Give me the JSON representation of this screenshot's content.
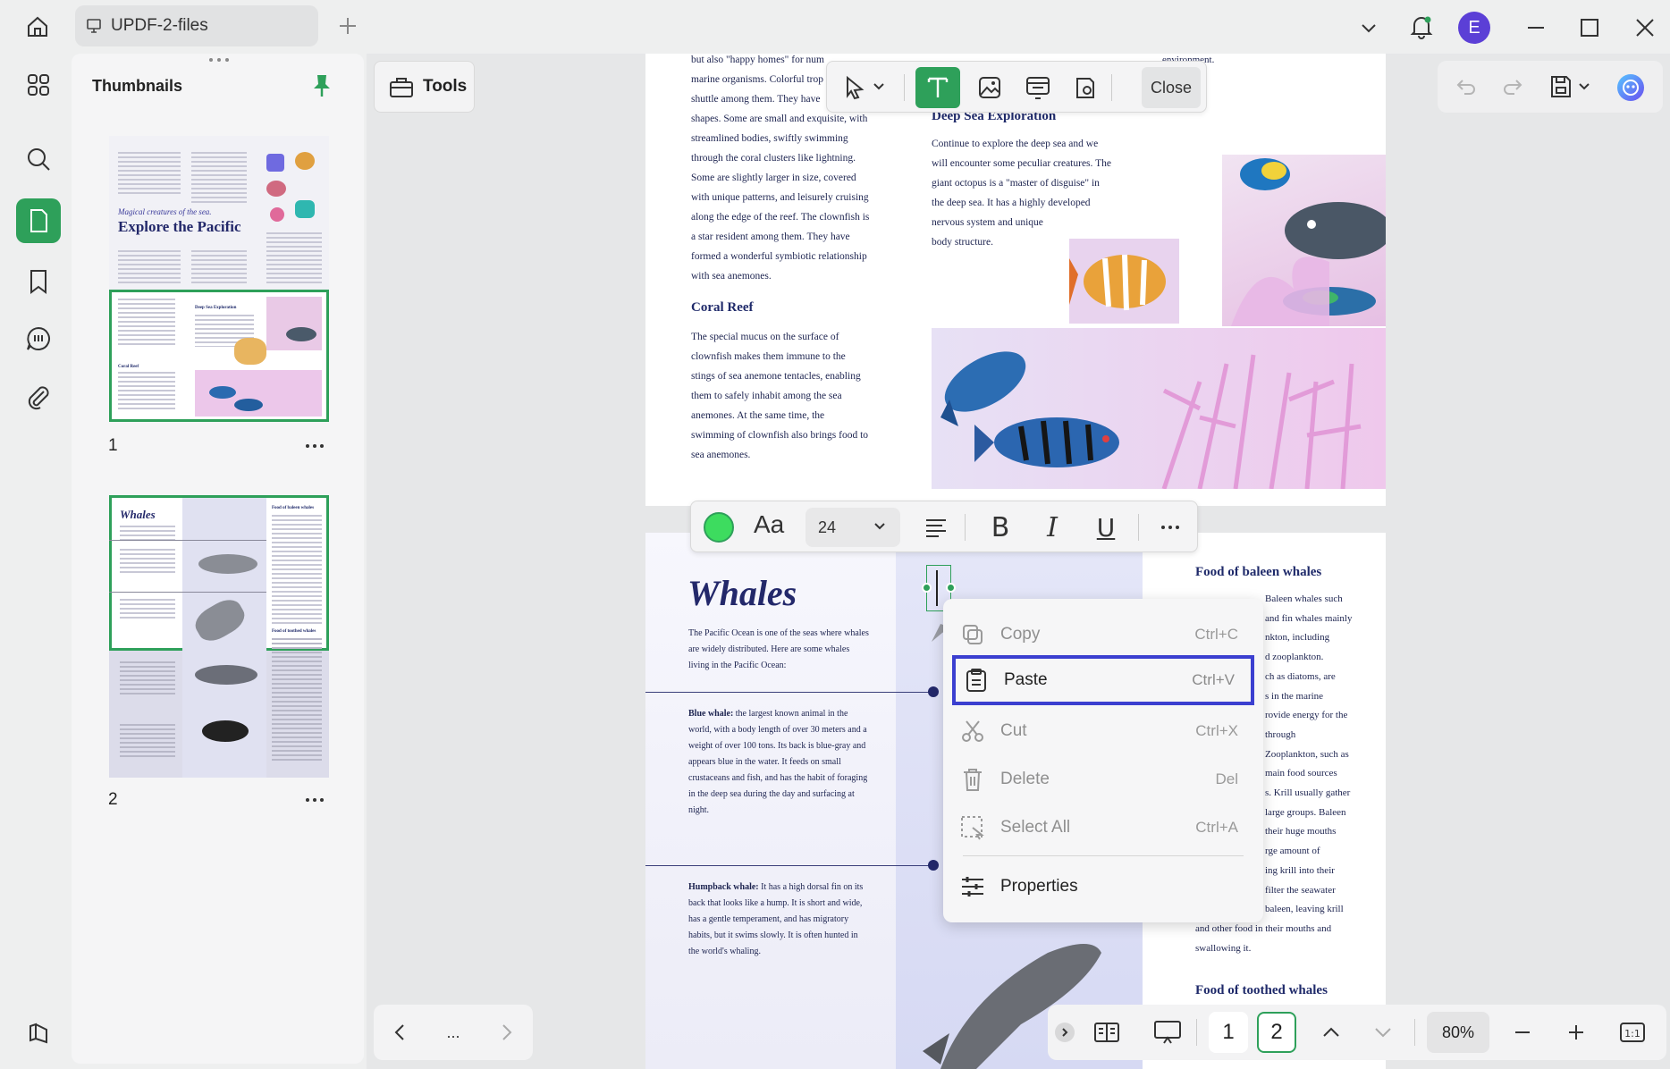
{
  "tab": {
    "title": "UPDF-2-files"
  },
  "user": {
    "avatar_letter": "E"
  },
  "thumbnails": {
    "title": "Thumbnails",
    "page1_label": "1",
    "page2_label": "2",
    "p1_subtitle": "Magical creatures of the sea.",
    "p1_title": "Explore the Pacific",
    "p2_title": "Whales",
    "p2_h_baleen": "Food of baleen whales",
    "p2_h_toothed": "Food of toothed whales",
    "p1_h_deep": "Deep Sea Exploration",
    "p1_h_coral": "Coral Reef"
  },
  "tools": {
    "label": "Tools"
  },
  "edit_toolbar": {
    "close_label": "Close"
  },
  "format_toolbar": {
    "font_size": "24",
    "color": "#3ddc5f"
  },
  "page1": {
    "col1_text": [
      "but also \"happy homes\" for num",
      "marine organisms. Colorful trop",
      "shuttle among them. They have",
      "shapes. Some are small and exquisite, with",
      "streamlined bodies, swiftly swimming",
      "through the coral clusters like lightning.",
      "Some are slightly larger in size, covered",
      "with unique patterns, and leisurely cruising",
      "along the edge of the reef. The clownfish is",
      "a star resident among them. They have",
      "formed a wonderful symbiotic relationship",
      "with sea anemones."
    ],
    "coral_heading": "Coral Reef",
    "coral_text": [
      "The special mucus on the surface of",
      "clownfish makes them immune to the",
      "stings of sea anemone tentacles, enabling",
      "them to safely inhabit among the sea",
      "anemones. At the same time, the",
      "swimming of clownfish also brings food to",
      "sea anemones."
    ],
    "top_right_fragment": "environment.",
    "deep_heading": "Deep Sea Exploration",
    "deep_text": [
      "Continue to explore the deep sea and we",
      "will encounter some peculiar creatures. The",
      "giant octopus is a \"master of disguise\" in",
      "the deep sea. It has a highly developed",
      "nervous system and unique",
      "body structure."
    ]
  },
  "page2": {
    "title": "Whales",
    "intro": [
      "The Pacific Ocean is one of the seas where whales",
      "are widely distributed. Here are some whales",
      "living in the Pacific Ocean:"
    ],
    "blue_label": "Blue whale:",
    "blue_text": [
      " the largest known animal in the",
      "world, with a body length of over 30 meters and a",
      "weight of over 100 tons. Its back is blue-gray and",
      "appears blue in the water. It feeds on small",
      "crustaceans and fish, and has the habit of foraging",
      "in the deep sea during the day and surfacing at",
      "night."
    ],
    "humpback_label": "Humpback whale:",
    "humpback_text": [
      " It has a high dorsal fin on its",
      "back that looks like a hump. It is short and wide,",
      "has a gentle temperament, and has migratory",
      "habits, but it swims slowly. It is often hunted in",
      "the world's whaling."
    ],
    "baleen_heading": "Food of baleen whales",
    "baleen_text": [
      "Baleen whales such",
      "and fin whales mainly",
      "nkton, including",
      "d zooplankton.",
      "ch as diatoms, are",
      "s in the marine",
      "rovide energy for the",
      "through",
      "Zooplankton, such as",
      "main food sources",
      "s. Krill usually gather",
      "large groups. Baleen",
      "their huge mouths",
      "rge amount of",
      "ing krill into their",
      "filter the seawater",
      "baleen, leaving krill",
      "and other food in their mouths and",
      "swallowing it."
    ],
    "toothed_heading": "Food of toothed whales"
  },
  "context_menu": {
    "items": [
      {
        "label": "Copy",
        "shortcut": "Ctrl+C"
      },
      {
        "label": "Paste",
        "shortcut": "Ctrl+V"
      },
      {
        "label": "Cut",
        "shortcut": "Ctrl+X"
      },
      {
        "label": "Delete",
        "shortcut": "Del"
      },
      {
        "label": "Select All",
        "shortcut": "Ctrl+A"
      },
      {
        "label": "Properties",
        "shortcut": ""
      }
    ]
  },
  "nav": {
    "more": "..."
  },
  "pages": {
    "page_a": "1",
    "page_b": "2"
  },
  "zoom": {
    "level": "80%",
    "fit_label": "1:1"
  },
  "colors": {
    "accent": "#2ea05a",
    "highlight": "#3b3fd0",
    "avatar": "#5b3fd6"
  }
}
